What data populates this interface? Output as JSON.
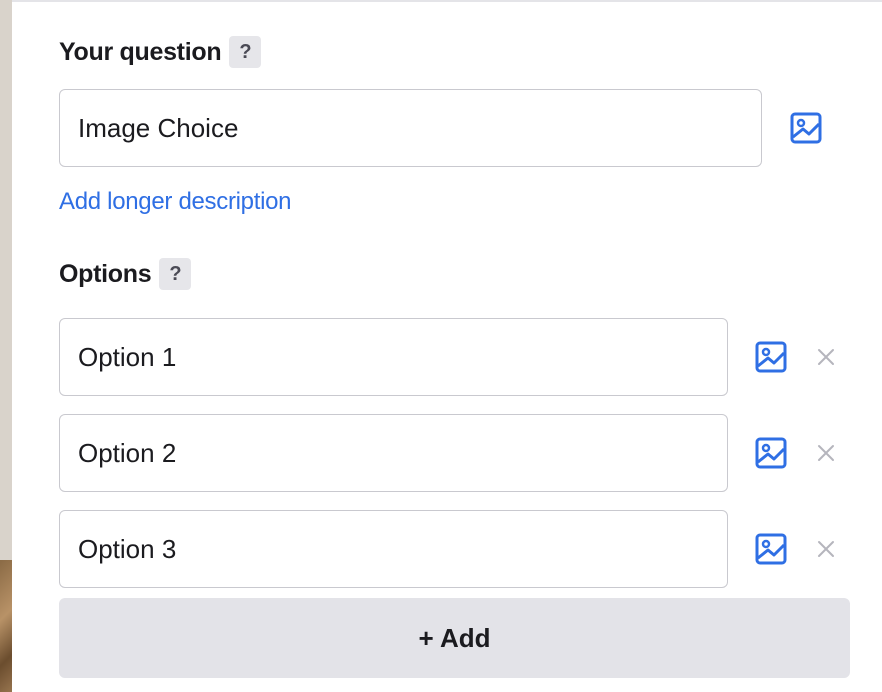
{
  "question": {
    "label": "Your question",
    "help": "?",
    "value": "Image Choice",
    "image_icon": "image-icon",
    "description_link": "Add longer description"
  },
  "options": {
    "label": "Options",
    "help": "?",
    "items": [
      {
        "value": "Option 1"
      },
      {
        "value": "Option 2"
      },
      {
        "value": "Option 3"
      }
    ],
    "image_icon": "image-icon",
    "remove_icon": "close-icon",
    "add_label": "+ Add"
  },
  "colors": {
    "accent": "#2f6fe4",
    "remove": "#b5b5bd",
    "add_button_bg": "#e3e3e8"
  }
}
